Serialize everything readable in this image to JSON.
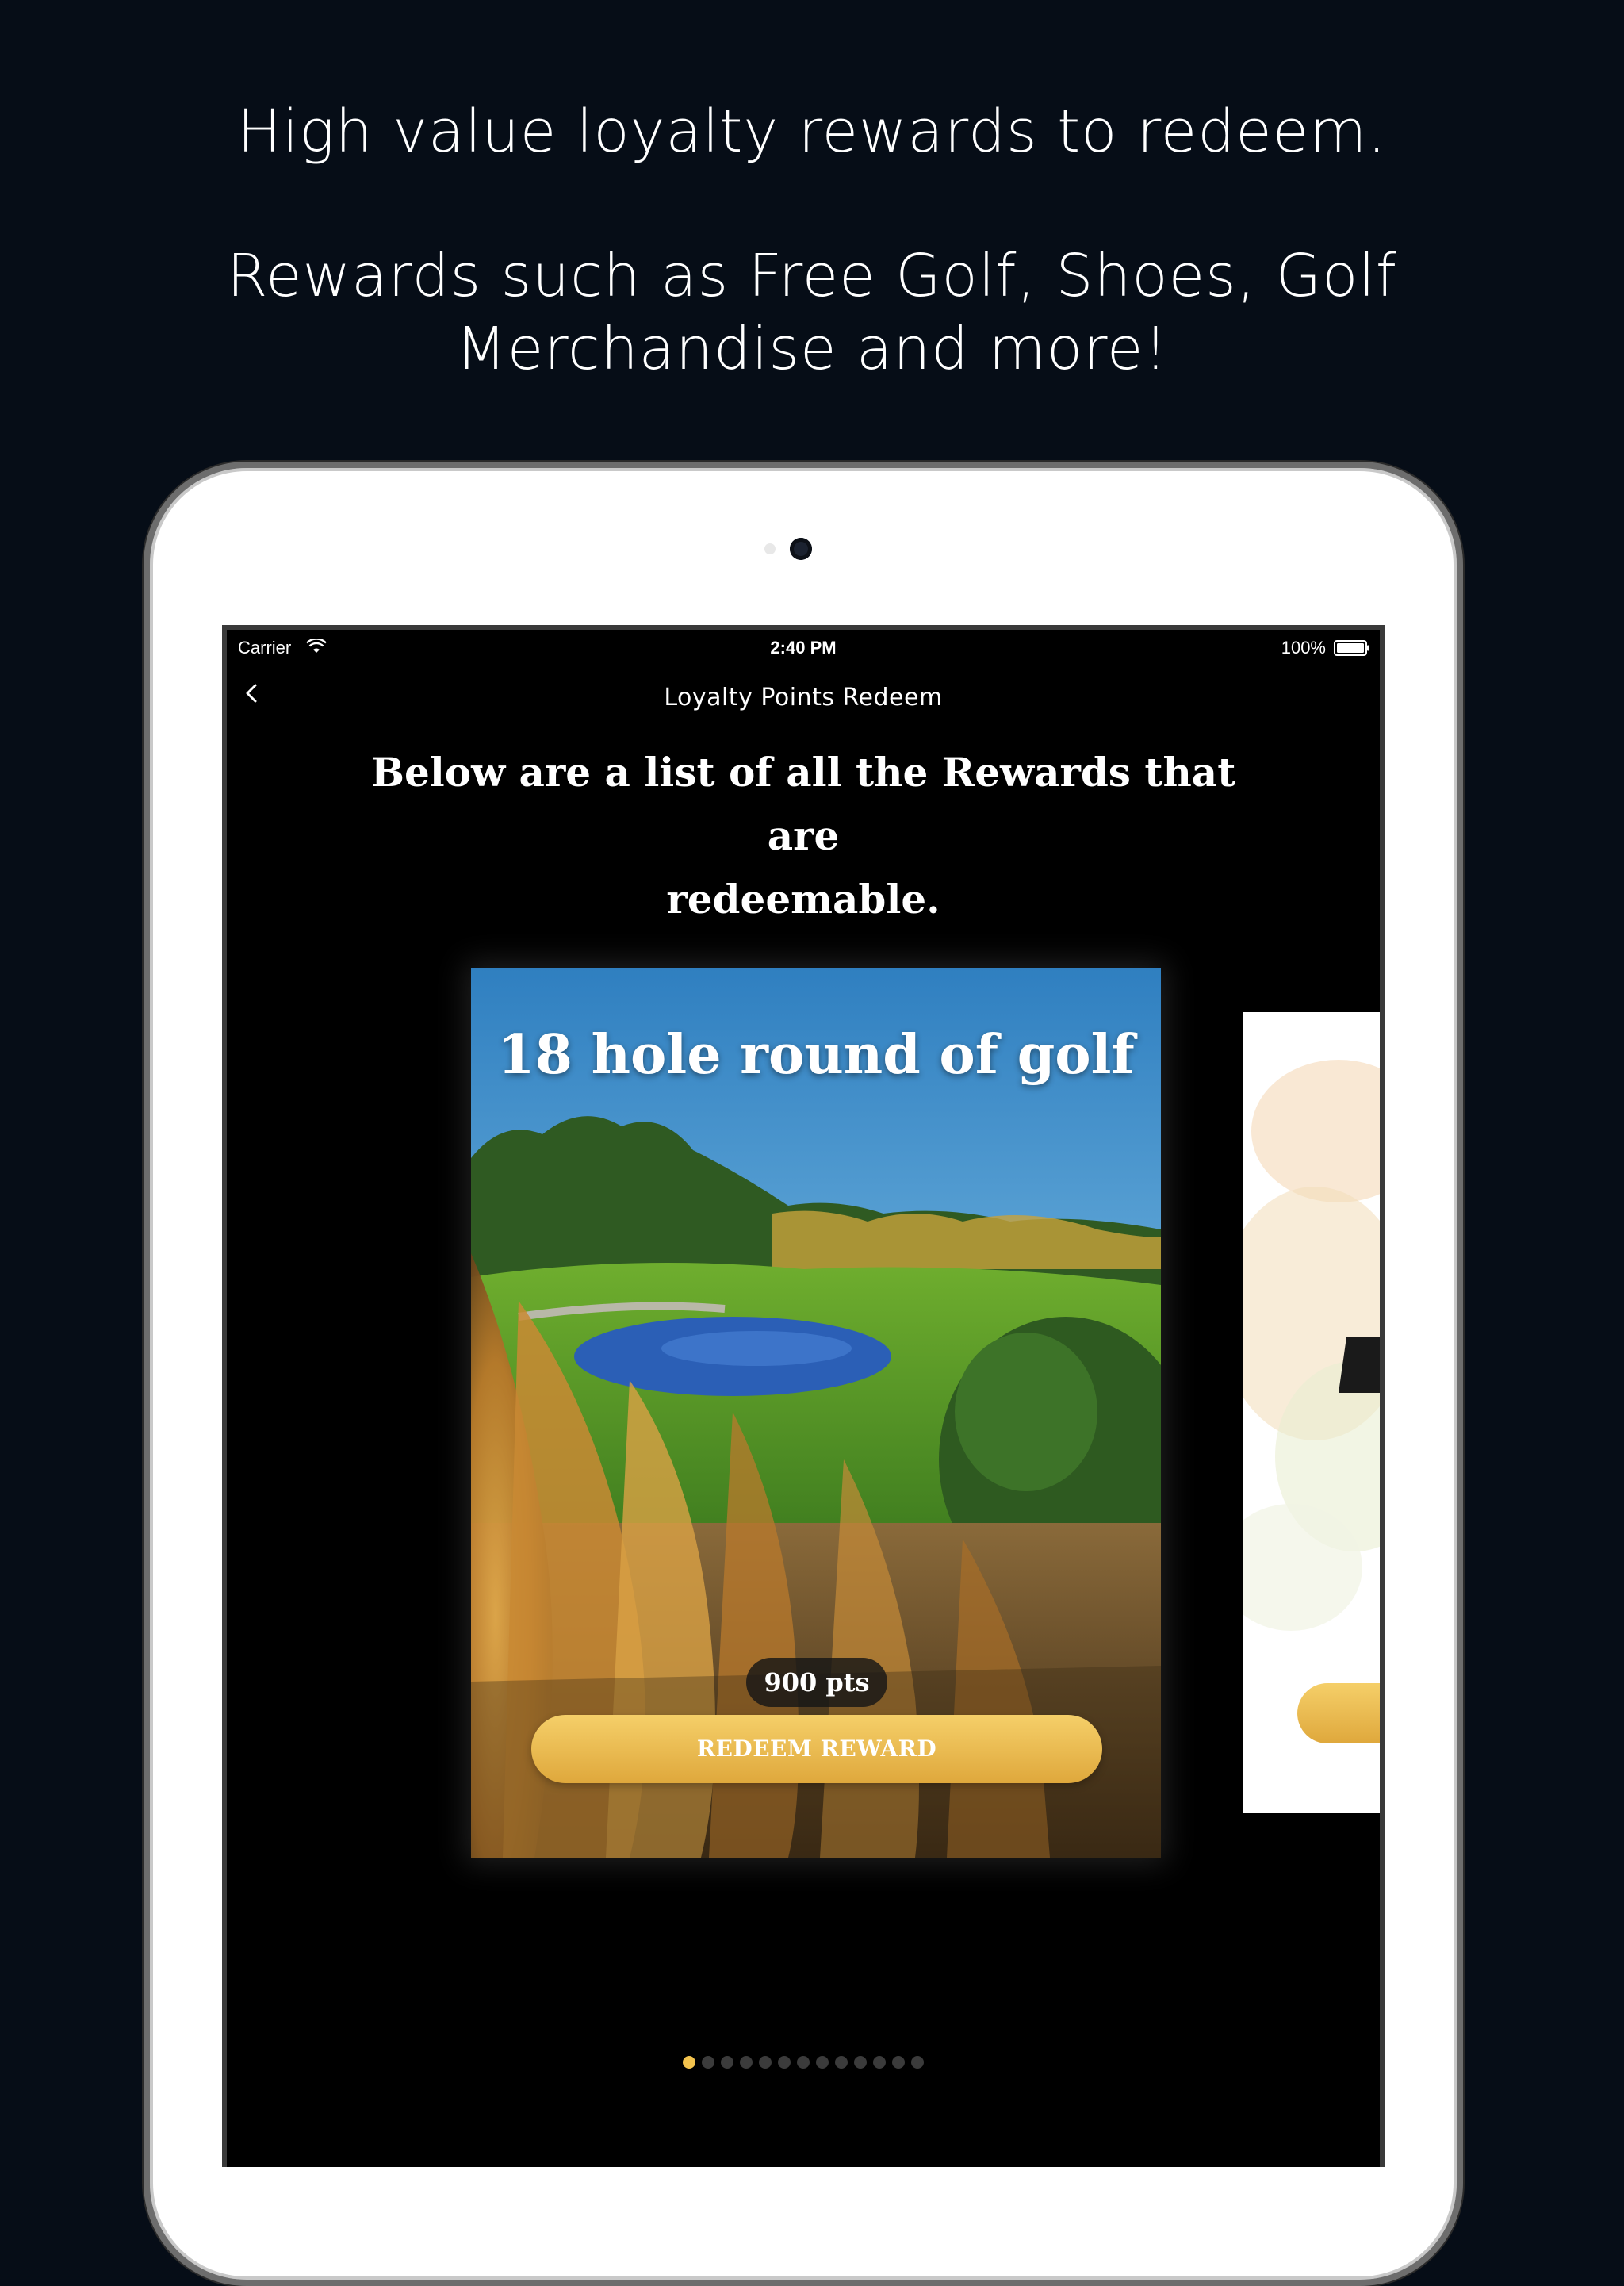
{
  "promo": {
    "headline": "High value loyalty rewards to redeem.",
    "subheadline_line1": "Rewards such as Free Golf, Shoes, Golf",
    "subheadline_line2": "Merchandise and more!"
  },
  "status_bar": {
    "carrier": "Carrier",
    "time": "2:40 PM",
    "battery": "100%"
  },
  "nav": {
    "title": "Loyalty Points Redeem",
    "back_icon": "chevron-left-icon"
  },
  "intro": {
    "text_line1": "Below are a list of all the Rewards that are",
    "text_line2": "redeemable."
  },
  "rewards": [
    {
      "title": "18 hole round of golf",
      "points": "900 pts",
      "button_label": "REDEEM REWARD"
    }
  ],
  "pagination": {
    "total": 13,
    "active": 0
  },
  "colors": {
    "background": "#060d17",
    "accent_gold": "#f2c24d",
    "screen": "#000000"
  }
}
